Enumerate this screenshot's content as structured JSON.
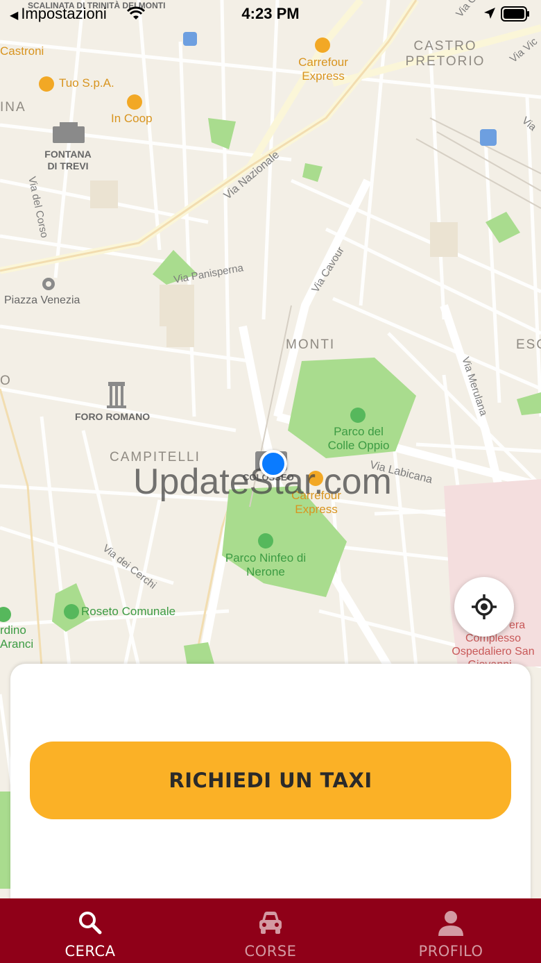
{
  "status_bar": {
    "back_app": "Impostazioni",
    "time": "4:23 PM"
  },
  "map": {
    "districts": [
      "CASTRO PRETORIO",
      "MONTI",
      "CAMPITELLI",
      "ESQ",
      "INA",
      "O"
    ],
    "streets": [
      "Via Nazionale",
      "Via Panisperna",
      "Via Cavour",
      "Via Merulana",
      "Via Labicana",
      "Via dei Cerchi",
      "Via del Corso",
      "Via G",
      "Via Vic",
      "Via"
    ],
    "pois": {
      "scalinata": "SCALINATA DI TRINITÀ DEI MONTI",
      "castroni": "Castroni",
      "tuo": "Tuo S.p.A.",
      "incoop": "In Coop",
      "carrefour_top": "Carrefour Express",
      "fontana": "FONTANA DI TREVI",
      "piazza_venezia": "Piazza Venezia",
      "foro_romano": "FORO ROMANO",
      "parco_colle": "Parco del Colle Oppio",
      "colosseo": "COLOSSEO",
      "carrefour_mid": "Carrefour Express",
      "parco_ninfeo": "Parco Ninfeo di Nerone",
      "roseto": "Roseto Comunale",
      "giardino": "rdino Aranci",
      "ospedale": "Complesso Ospedaliero San Giovanni -",
      "ospedale_top": "era"
    },
    "watermark": "UpdateStar.com"
  },
  "actions": {
    "request_taxi": "RICHIEDI UN TAXI"
  },
  "tabs": [
    {
      "label": "CERCA",
      "icon": "search-icon",
      "active": true
    },
    {
      "label": "CORSE",
      "icon": "car-icon",
      "active": false
    },
    {
      "label": "PROFILO",
      "icon": "person-icon",
      "active": false
    }
  ],
  "colors": {
    "accent": "#fbb126",
    "tab_bar": "#8f0018",
    "user_location": "#0a7bff",
    "park": "#a9dc8e"
  }
}
